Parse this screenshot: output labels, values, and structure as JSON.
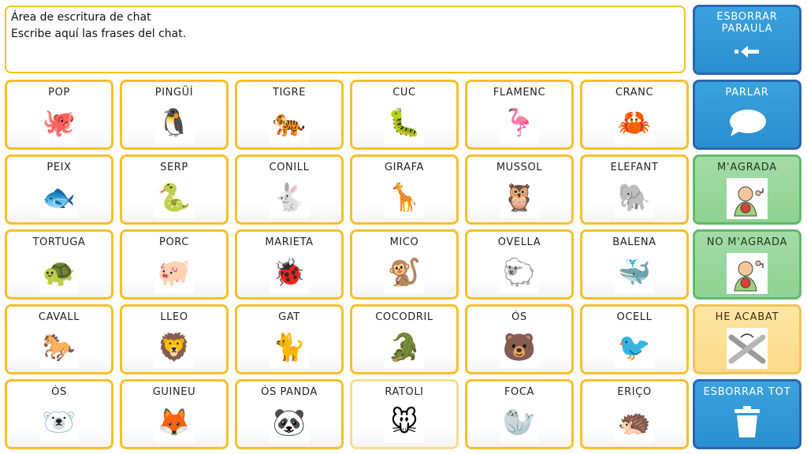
{
  "chat": {
    "line1": "Área de escritura de chat",
    "line2": "Escribe aquí las frases del chat."
  },
  "cells": [
    {
      "label": "POP",
      "icon": "🐙"
    },
    {
      "label": "PINGÜÍ",
      "icon": "🐧"
    },
    {
      "label": "TIGRE",
      "icon": "🐅"
    },
    {
      "label": "CUC",
      "icon": "🐛"
    },
    {
      "label": "FLAMENC",
      "icon": "🦩"
    },
    {
      "label": "CRANC",
      "icon": "🦀"
    },
    {
      "label": "PEIX",
      "icon": "🐟"
    },
    {
      "label": "SERP",
      "icon": "🐍"
    },
    {
      "label": "CONILL",
      "icon": "🐇"
    },
    {
      "label": "GIRAFA",
      "icon": "🦒"
    },
    {
      "label": "MUSSOL",
      "icon": "🦉"
    },
    {
      "label": "ELEFANT",
      "icon": "🐘"
    },
    {
      "label": "TORTUGA",
      "icon": "🐢"
    },
    {
      "label": "PORC",
      "icon": "🐖"
    },
    {
      "label": "MARIETA",
      "icon": "🐞"
    },
    {
      "label": "MICO",
      "icon": "🐒"
    },
    {
      "label": "OVELLA",
      "icon": "🐑"
    },
    {
      "label": "BALENA",
      "icon": "🐳"
    },
    {
      "label": "CAVALL",
      "icon": "🐎"
    },
    {
      "label": "LLEO",
      "icon": "🦁"
    },
    {
      "label": "GAT",
      "icon": "🐈"
    },
    {
      "label": "COCODRIL",
      "icon": "🐊"
    },
    {
      "label": "ÓS",
      "icon": "🐻"
    },
    {
      "label": "OCELL",
      "icon": "🐦"
    },
    {
      "label": "ÓS",
      "icon": "🐻‍❄️"
    },
    {
      "label": "GUINEU",
      "icon": "🦊"
    },
    {
      "label": "ÓS PANDA",
      "icon": "🐼"
    },
    {
      "label": "RATOLI",
      "icon": "🐭"
    },
    {
      "label": "FOCA",
      "icon": "🦭"
    },
    {
      "label": "ERIÇO",
      "icon": "🦔"
    }
  ],
  "side": {
    "delete_word_line1": "ESBORRAR",
    "delete_word_line2": "PARAULA",
    "speak": "PARLAR",
    "like": "M'AGRADA",
    "dislike": "NO M'AGRADA",
    "finished": "HE ACABAT",
    "clear_all": "ESBORRAR TOT"
  },
  "colors": {
    "cell_border": "#f5c02b",
    "blue_button": "#3aa2dc",
    "green_button": "#a4dba7",
    "yellow_button": "#fde7a4"
  }
}
